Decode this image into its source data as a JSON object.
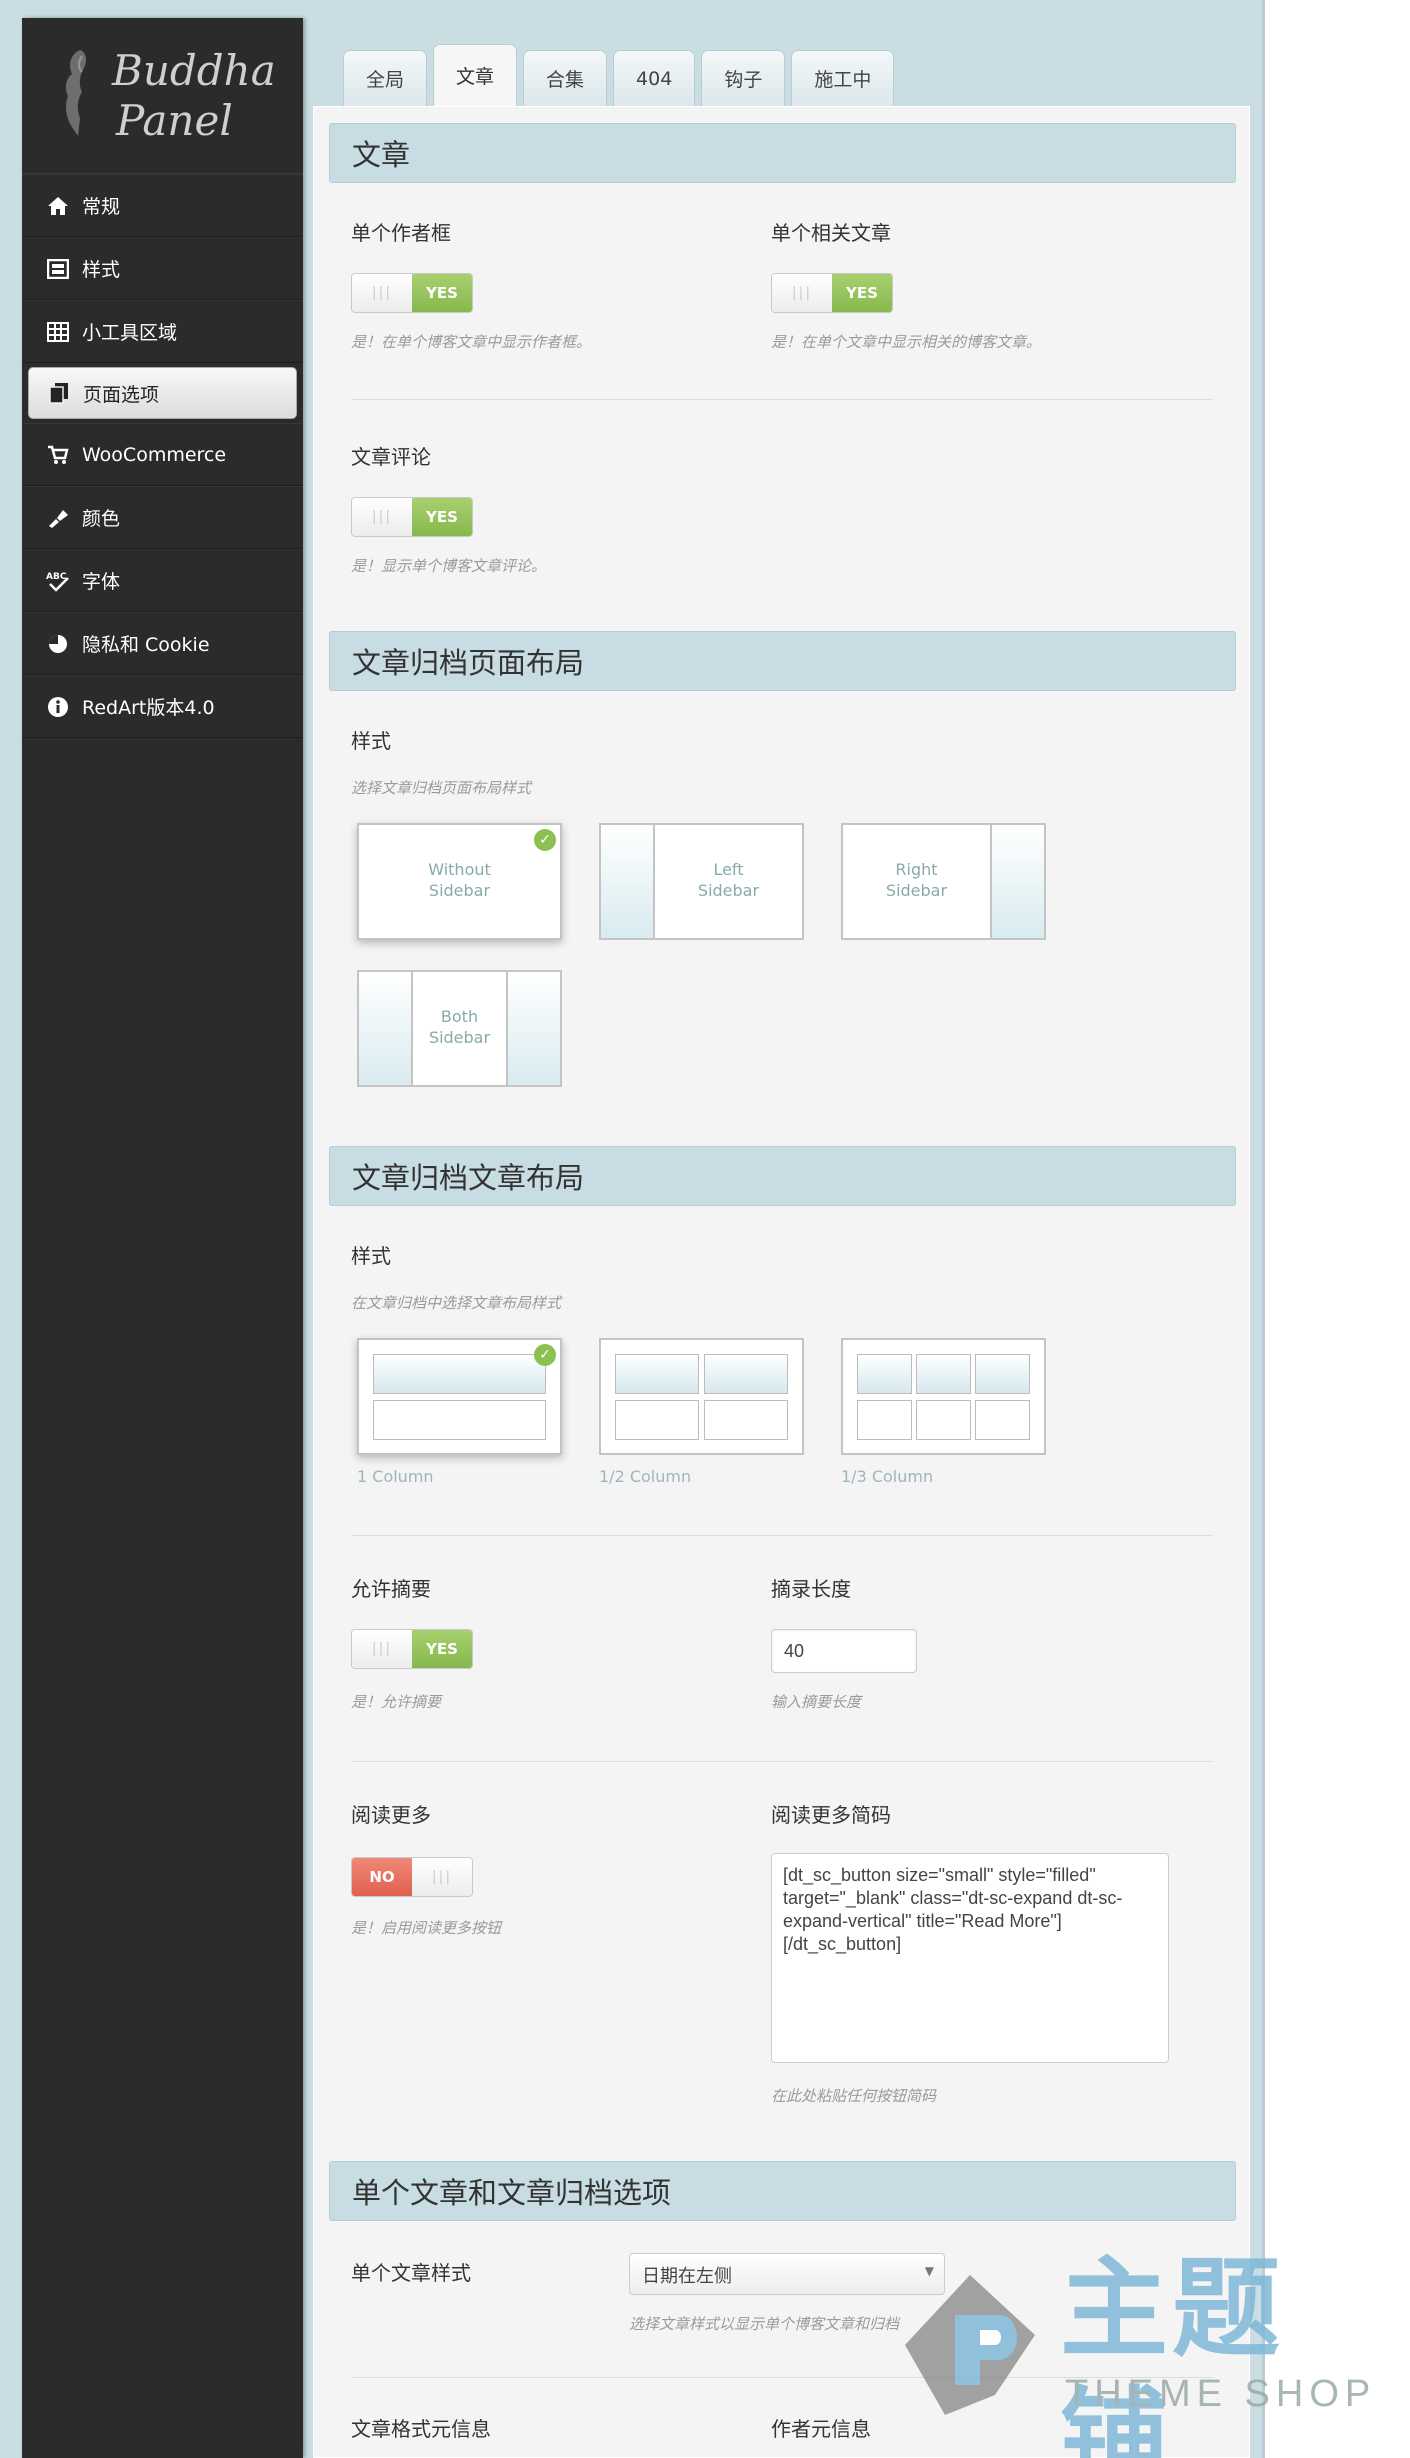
{
  "sidebar": {
    "logo_line1": "Buddha",
    "logo_line2": "Panel",
    "items": [
      {
        "label": "常规"
      },
      {
        "label": "样式"
      },
      {
        "label": "小工具区域"
      },
      {
        "label": "页面选项"
      },
      {
        "label": "WooCommerce"
      },
      {
        "label": "颜色"
      },
      {
        "label": "字体"
      },
      {
        "label": "隐私和 Cookie"
      },
      {
        "label": "RedArt版本4.0"
      }
    ]
  },
  "tabs": [
    "全局",
    "文章",
    "合集",
    "404",
    "钩子",
    "施工中"
  ],
  "section1": {
    "title": "文章",
    "author_box_label": "单个作者框",
    "author_box_hint": "是！在单个博客文章中显示作者框。",
    "related_label": "单个相关文章",
    "related_hint": "是！在单个文章中显示相关的博客文章。",
    "comments_label": "文章评论",
    "comments_hint": "是！显示单个博客文章评论。",
    "toggle_yes": "YES",
    "toggle_grip": "|||"
  },
  "section2": {
    "title": "文章归档页面布局",
    "style_label": "样式",
    "style_hint": "选择文章归档页面布局样式",
    "layouts": [
      {
        "line1": "Without",
        "line2": "Sidebar"
      },
      {
        "line1": "Left",
        "line2": "Sidebar"
      },
      {
        "line1": "Right",
        "line2": "Sidebar"
      },
      {
        "line1": "Both",
        "line2": "Sidebar"
      }
    ]
  },
  "section3": {
    "title": "文章归档文章布局",
    "style_label": "样式",
    "style_hint": "在文章归档中选择文章布局样式",
    "columns": [
      "1 Column",
      "1/2 Column",
      "1/3 Column"
    ],
    "excerpt_label": "允许摘要",
    "excerpt_hint": "是！允许摘要",
    "excerpt_length_label": "摘录长度",
    "excerpt_length_value": "40",
    "excerpt_length_hint": "输入摘要长度",
    "read_more_label": "阅读更多",
    "read_more_hint": "是！启用阅读更多按钮",
    "toggle_no": "NO",
    "shortcode_label": "阅读更多简码",
    "shortcode_value": "[dt_sc_button size=\"small\" style=\"filled\"\ntarget=\"_blank\" class=\"dt-sc-expand dt-sc-\nexpand-vertical\" title=\"Read More\"]\n[/dt_sc_button]",
    "shortcode_hint": "在此处粘贴任何按钮简码"
  },
  "section4": {
    "title": "单个文章和文章归档选项",
    "single_style_label": "单个文章样式",
    "single_style_value": "日期在左侧",
    "single_style_hint": "选择文章样式以显示单个博客文章和归档",
    "format_meta_label": "文章格式元信息",
    "author_meta_label": "作者元信息"
  },
  "watermark": {
    "text": "主题铺",
    "sub": "THEME SHOP"
  },
  "colors": {
    "accent": "#c8dde3",
    "yes": "#8cc152",
    "no": "#e0604d",
    "sidebar": "#2b2b2b"
  }
}
